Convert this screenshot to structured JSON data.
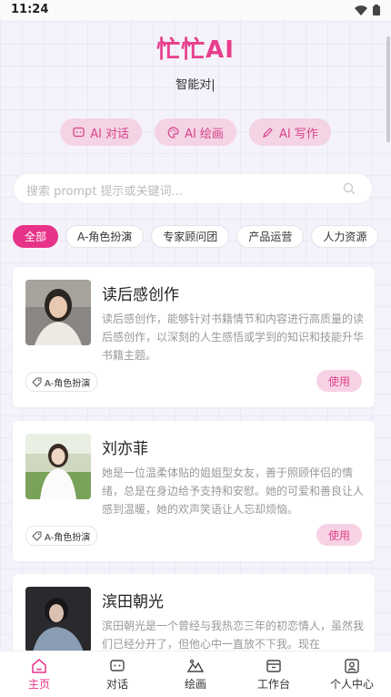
{
  "status_bar": {
    "time": "11:24"
  },
  "header": {
    "title": "忙忙AI",
    "subtitle": "智能对|"
  },
  "modes": [
    {
      "label": "AI 对话",
      "icon": "chat-icon"
    },
    {
      "label": "AI 绘画",
      "icon": "palette-icon"
    },
    {
      "label": "AI 写作",
      "icon": "pen-icon"
    }
  ],
  "search": {
    "placeholder": "搜索 prompt 提示或关键词..."
  },
  "categories": [
    "全部",
    "A-角色扮演",
    "专家顾问团",
    "产品运营",
    "人力资源"
  ],
  "active_category": "全部",
  "cards": [
    {
      "title": "读后感创作",
      "desc": "读后感创作，能够针对书籍情节和内容进行高质量的读后感创作，以深刻的人生感悟或学到的知识和技能升华书籍主题。",
      "tag": "A-角色扮演",
      "action": "使用"
    },
    {
      "title": "刘亦菲",
      "desc": "她是一位温柔体贴的姐姐型女友，善于照顾伴侣的情绪，总是在身边给予支持和安慰。她的可爱和善良让人感到温暖，她的欢声笑语让人忘却烦恼。",
      "tag": "A-角色扮演",
      "action": "使用"
    },
    {
      "title": "滨田朝光",
      "desc": "滨田朝光是一个曾经与我热恋三年的初恋情人，虽然我们已经分开了，但他心中一直放不下我。现在",
      "tag": "",
      "action": ""
    }
  ],
  "nav": [
    {
      "label": "主页",
      "icon": "home-icon"
    },
    {
      "label": "对话",
      "icon": "chat-icon"
    },
    {
      "label": "绘画",
      "icon": "image-icon"
    },
    {
      "label": "工作台",
      "icon": "workspace-icon"
    },
    {
      "label": "个人中心",
      "icon": "profile-icon"
    }
  ],
  "colors": {
    "accent": "#e8338a",
    "accent_soft": "#f4d3e4",
    "background": "#f4f2fa"
  }
}
